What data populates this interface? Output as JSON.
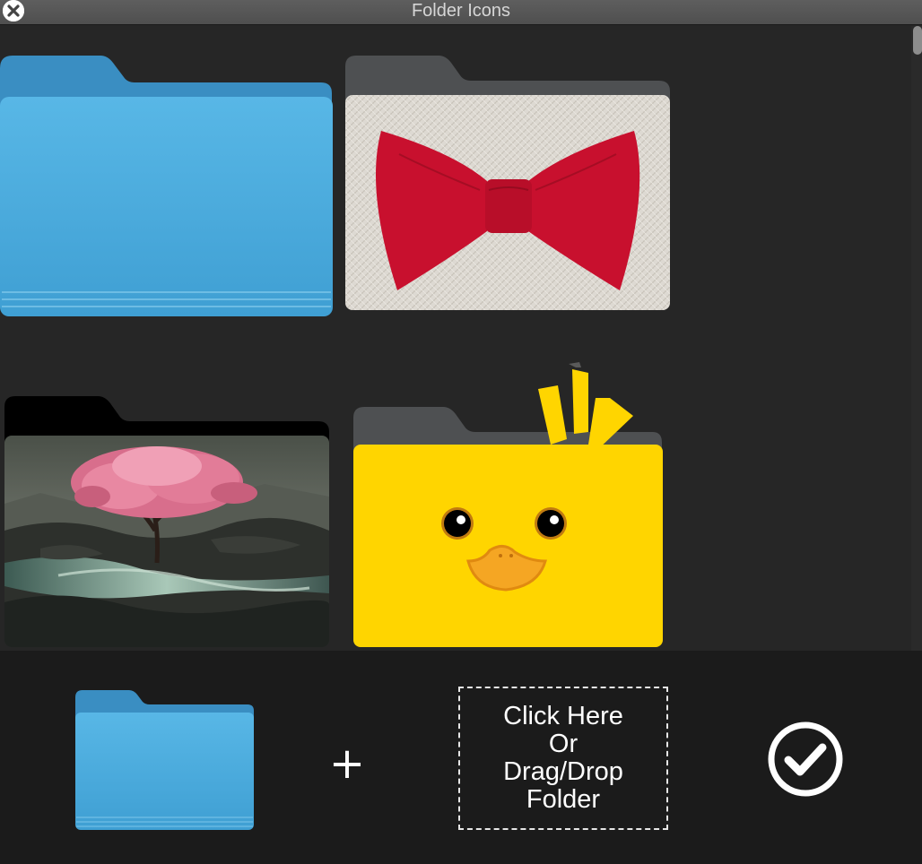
{
  "window": {
    "title": "Folder Icons"
  },
  "icons": {
    "close": "close-icon",
    "add": "plus-icon",
    "confirm": "checkmark-icon"
  },
  "grid": {
    "tiles": [
      {
        "name": "folder-tile-blue"
      },
      {
        "name": "folder-tile-bow-tie"
      },
      {
        "name": "folder-tile-cherry-tree"
      },
      {
        "name": "folder-tile-duck"
      }
    ]
  },
  "toolbar": {
    "plus_label": "+",
    "drop_zone_lines": [
      "Click Here",
      "Or",
      "Drag/Drop",
      "Folder"
    ]
  },
  "colors": {
    "folder_blue": "#4aa9d9",
    "folder_tab_gray": "#4e5052",
    "duck_yellow": "#ffd500",
    "bow_red": "#c8102e",
    "background": "#262626",
    "toolbar_bg": "#1b1b1b"
  }
}
